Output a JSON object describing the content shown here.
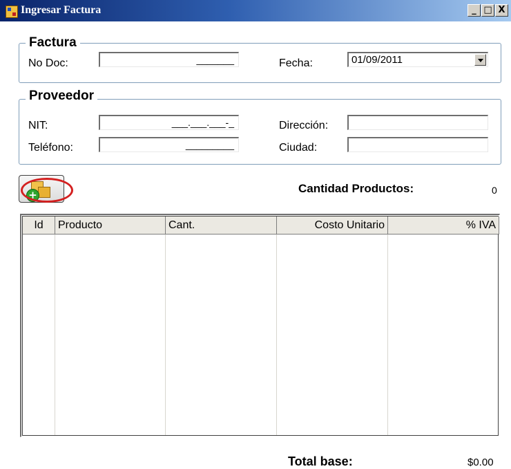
{
  "window": {
    "title": "Ingresar Factura",
    "controls": {
      "minimize": "_",
      "maximize": "□",
      "close": "X"
    }
  },
  "factura": {
    "group_title": "Factura",
    "no_doc_label": "No Doc:",
    "no_doc_mask": "_______",
    "fecha_label": "Fecha:",
    "fecha_value": "01/09/2011"
  },
  "proveedor": {
    "group_title": "Proveedor",
    "nit_label": "NIT:",
    "nit_mask": "___.___.___-_",
    "telefono_label": "Teléfono:",
    "telefono_mask": "_________",
    "direccion_label": "Dirección:",
    "ciudad_label": "Ciudad:"
  },
  "productos": {
    "add_icon": "add-product-icon",
    "cantidad_label": "Cantidad Productos:",
    "cantidad_value": "0",
    "columns": [
      "Id",
      "Producto",
      "Cant.",
      "Costo Unitario",
      "% IVA"
    ]
  },
  "totals": {
    "total_base_label": "Total base:",
    "total_base_value": "$0.00"
  },
  "colors": {
    "title_start": "#0a246a",
    "title_end": "#a6caf0",
    "group_border": "#7f9db9",
    "highlight_ring": "#d42020"
  }
}
